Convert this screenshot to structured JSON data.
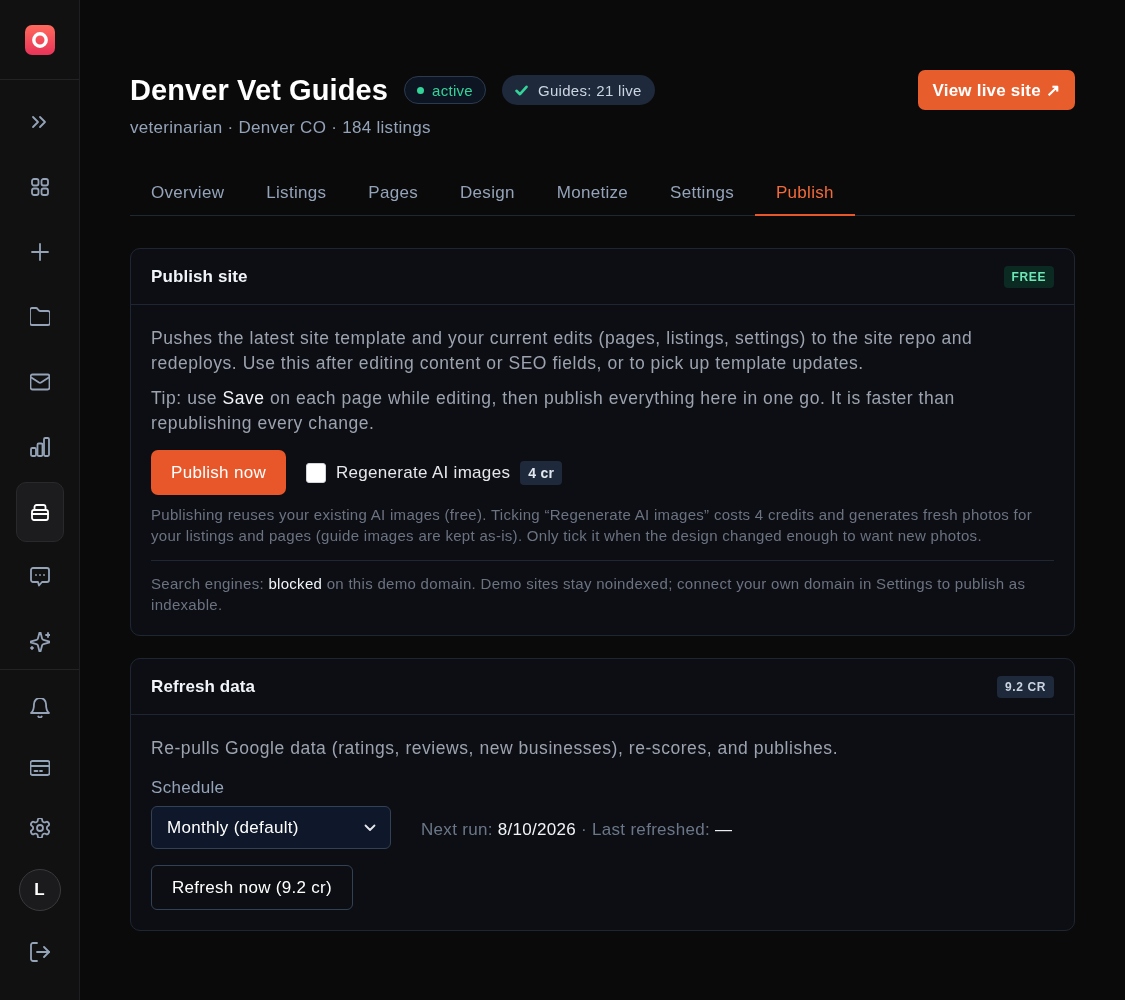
{
  "sidebar": {
    "nav": [
      {
        "kind": "expand",
        "selected": false
      },
      {
        "kind": "dashboard",
        "selected": false
      },
      {
        "kind": "create",
        "selected": false
      },
      {
        "kind": "projects",
        "selected": false
      },
      {
        "kind": "mail",
        "selected": false
      },
      {
        "kind": "analytics",
        "selected": false
      },
      {
        "kind": "sites",
        "selected": true
      },
      {
        "kind": "messages",
        "selected": false
      },
      {
        "kind": "ai",
        "selected": false
      }
    ],
    "footer": [
      {
        "kind": "notifications"
      },
      {
        "kind": "billing"
      },
      {
        "kind": "settings"
      },
      {
        "kind": "avatar",
        "initial": "L"
      },
      {
        "kind": "logout"
      }
    ]
  },
  "header": {
    "title": "Denver Vet Guides",
    "status": "active",
    "guides": "Guides: 21 live",
    "subtitle": "veterinarian · Denver CO · 184 listings",
    "view_button": "View live site ↗"
  },
  "tabs": [
    {
      "label": "Overview",
      "selected": false
    },
    {
      "label": "Listings",
      "selected": false
    },
    {
      "label": "Pages",
      "selected": false
    },
    {
      "label": "Design",
      "selected": false
    },
    {
      "label": "Monetize",
      "selected": false
    },
    {
      "label": "Settings",
      "selected": false
    },
    {
      "label": "Publish",
      "selected": true
    }
  ],
  "publish_site": {
    "title": "Publish site",
    "badge": {
      "label": "FREE",
      "kind": "success"
    },
    "description": "Pushes the latest site template and your current edits (pages, listings, settings) to the site repo and redeploys. Use this after editing content or SEO fields, or to pick up template updates.",
    "tip": "Tip: use **Save** on each page while editing, then publish everything here in one go. It is faster than republishing every change.",
    "publish_button": "Publish now",
    "regenerate": {
      "label": "Regenerate AI images",
      "checked": false,
      "cost": "4 cr"
    },
    "note": "Publishing reuses your existing AI images (free). Ticking “Regenerate AI images” costs 4 credits and generates fresh photos for your listings and pages (guide images are kept as-is). Only tick it when the design changed enough to want new photos.",
    "seo_note": "Search engines: **blocked** on this demo domain. Demo sites stay noindexed; connect your own domain in Settings to publish as indexable."
  },
  "refresh_data": {
    "title": "Refresh data",
    "badge": {
      "label": "9.2 CR",
      "kind": "neutral"
    },
    "description": "Re-pulls Google data (ratings, reviews, new businesses), re-scores, and publishes.",
    "schedule": {
      "label": "Schedule",
      "value": "Monthly (default)"
    },
    "status": "Next run: **8/10/2026** · Last refreshed: **—**",
    "refresh_button": "Refresh now (9.2 cr)"
  }
}
